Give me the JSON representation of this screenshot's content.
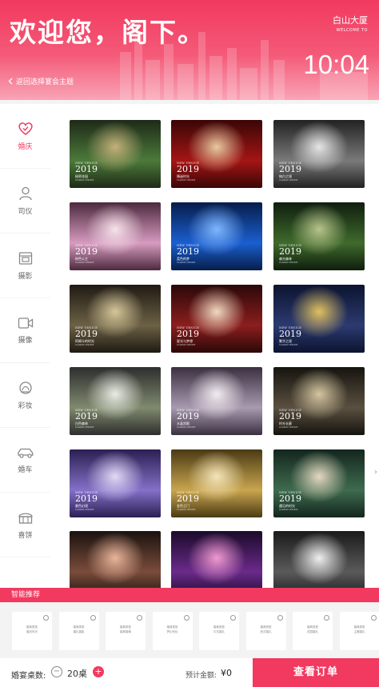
{
  "header": {
    "welcome": "欢迎您，阁下。",
    "hotel_name": "白山大厦",
    "hotel_sub": "WELCOME TO",
    "time": "10:04",
    "back_label": "返回选择宴会主题"
  },
  "sidebar": {
    "items": [
      {
        "label": "婚庆",
        "icon": "heart-icon",
        "active": true
      },
      {
        "label": "司仪",
        "icon": "person-icon"
      },
      {
        "label": "摄影",
        "icon": "photo-icon"
      },
      {
        "label": "摄像",
        "icon": "video-icon"
      },
      {
        "label": "彩妆",
        "icon": "makeup-icon"
      },
      {
        "label": "婚车",
        "icon": "car-icon"
      },
      {
        "label": "喜饼",
        "icon": "cake-icon"
      }
    ]
  },
  "themes": {
    "caption_en": "NEW VENICE",
    "year": "2019",
    "caption_sub": "CLASSIC CHOICE",
    "items": [
      {
        "name": "秘密花园",
        "colors": [
          "#1e2a18",
          "#4c7a3a",
          "#c3b07a"
        ]
      },
      {
        "name": "情迷时光",
        "colors": [
          "#3a0606",
          "#a51515",
          "#e8c8a0"
        ]
      },
      {
        "name": "纯白之境",
        "colors": [
          "#222222",
          "#7a7a7a",
          "#e6e6e6"
        ]
      },
      {
        "name": "粉色公主",
        "colors": [
          "#4c2a3e",
          "#d79bc0",
          "#f6e2ea"
        ]
      },
      {
        "name": "蓝色的梦",
        "colors": [
          "#061d4a",
          "#1b5fd0",
          "#7fb6ff"
        ]
      },
      {
        "name": "森光森林",
        "colors": [
          "#0f1e0e",
          "#3f6a2c",
          "#b6c48a"
        ]
      },
      {
        "name": "阿姆卡的时光",
        "colors": [
          "#1f1a12",
          "#6c6146",
          "#d5c79a"
        ]
      },
      {
        "name": "星光与梦想",
        "colors": [
          "#2b0808",
          "#8c1e1e",
          "#f0d9c0"
        ]
      },
      {
        "name": "繁华之境",
        "colors": [
          "#0c1430",
          "#2c3a70",
          "#e0c060"
        ]
      },
      {
        "name": "白色森林",
        "colors": [
          "#2e2e2e",
          "#7f8a6e",
          "#e9ece4"
        ]
      },
      {
        "name": "水晶宫殿",
        "colors": [
          "#3a3040",
          "#a89ab0",
          "#f2ecf0"
        ]
      },
      {
        "name": "时光长廊",
        "colors": [
          "#16140f",
          "#5a5040",
          "#d3c5a0"
        ]
      },
      {
        "name": "紫色幻境",
        "colors": [
          "#2b1f52",
          "#8470c8",
          "#e2d9f6"
        ]
      },
      {
        "name": "金色之门",
        "colors": [
          "#4a3a14",
          "#c9a54e",
          "#f4e5b8"
        ]
      },
      {
        "name": "遇见的时光",
        "colors": [
          "#13261e",
          "#3f6b4f",
          "#e4d8c0"
        ]
      },
      {
        "name": "",
        "colors": [
          "#1a120e",
          "#7a4c3c",
          "#e9b59a"
        ]
      },
      {
        "name": "",
        "colors": [
          "#1b0a2a",
          "#6a2a8a",
          "#f09ad0"
        ]
      },
      {
        "name": "",
        "colors": [
          "#1a1a1a",
          "#5a5a5a",
          "#efefef"
        ]
      }
    ]
  },
  "recommend": {
    "title": "智能推荐",
    "cards": [
      {
        "line1": "婚典类型",
        "line2": "婚庆时光"
      },
      {
        "line1": "婚典类型",
        "line2": "婚礼摄影"
      },
      {
        "line1": "婚典类型",
        "line2": "婚典摄像"
      },
      {
        "line1": "婚典类型",
        "line2": "梦幻司仪"
      },
      {
        "line1": "婚典类型",
        "line2": "中式婚礼"
      },
      {
        "line1": "婚典类型",
        "line2": "西式婚礼"
      },
      {
        "line1": "婚典类型",
        "line2": "花园婚礼"
      },
      {
        "line1": "婚典类型",
        "line2": "主题婚礼"
      }
    ]
  },
  "footer": {
    "tables_label": "婚宴桌数:",
    "tables_count": "20桌",
    "minus": "−",
    "plus": "+",
    "price_label": "预计金额:",
    "price": "¥0",
    "order_button": "查看订单"
  },
  "colors": {
    "accent": "#f2395f"
  }
}
